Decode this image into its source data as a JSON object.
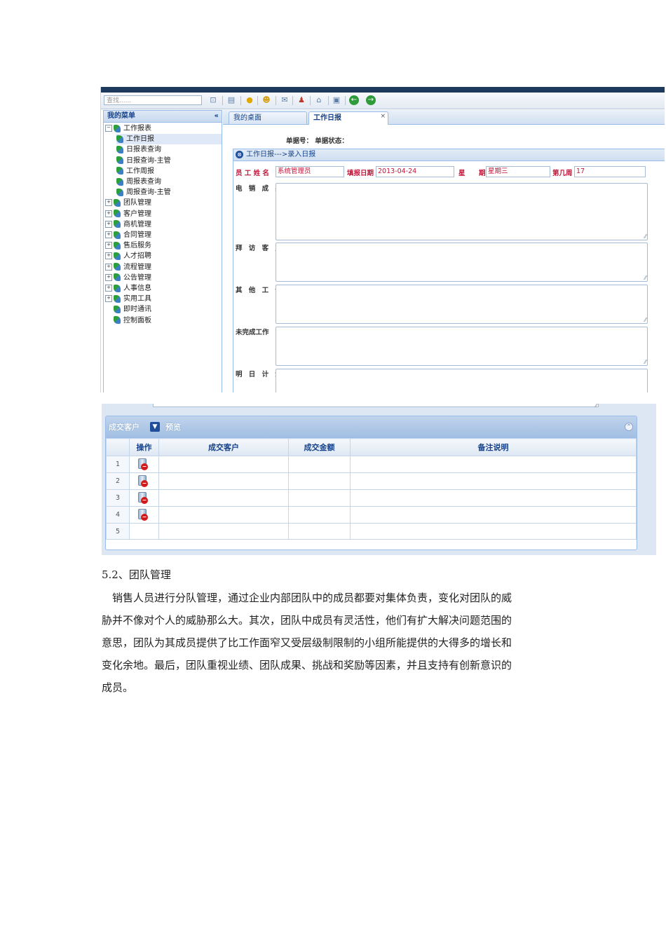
{
  "app": {
    "search_placeholder": "查找......",
    "sidebar": {
      "title": "我的菜单",
      "collapse_glyph": "«",
      "items": [
        {
          "label": "工作报表",
          "expander": "⊟",
          "level": 0
        },
        {
          "label": "工作日报",
          "level": 1,
          "selected": true
        },
        {
          "label": "日报表查询",
          "level": 1
        },
        {
          "label": "日报查询-主管",
          "level": 1
        },
        {
          "label": "工作周报",
          "level": 1
        },
        {
          "label": "周报表查询",
          "level": 1
        },
        {
          "label": "周报查询-主管",
          "level": 1
        },
        {
          "label": "团队管理",
          "expander": "⊞",
          "level": 0
        },
        {
          "label": "客户管理",
          "expander": "⊞",
          "level": 0
        },
        {
          "label": "商机管理",
          "expander": "⊞",
          "level": 0
        },
        {
          "label": "合同管理",
          "expander": "⊞",
          "level": 0
        },
        {
          "label": "售后服务",
          "expander": "⊞",
          "level": 0
        },
        {
          "label": "人才招聘",
          "expander": "⊞",
          "level": 0
        },
        {
          "label": "流程管理",
          "expander": "⊞",
          "level": 0
        },
        {
          "label": "公告管理",
          "expander": "⊞",
          "level": 0
        },
        {
          "label": "人事信息",
          "expander": "⊞",
          "level": 0
        },
        {
          "label": "实用工具",
          "expander": "⊞",
          "level": 0
        },
        {
          "label": "即时通讯",
          "level": 0
        },
        {
          "label": "控制面板",
          "level": 0
        }
      ]
    },
    "tabs": [
      {
        "label": "我的桌面"
      },
      {
        "label": "工作日报",
        "close": "×"
      }
    ],
    "form": {
      "doc_meta": "单据号：   单据状态：",
      "panel_title": "工作日报---&gt;录入日报",
      "employee_label": "员 工 姓 名",
      "employee_value": "系统管理员",
      "date_label": "填报日期",
      "date_value": "2013-04-24",
      "weekday_label": "星　　期",
      "weekday_value": "星期三",
      "week_label": "第几周",
      "week_value": "17",
      "textareas": [
        {
          "label": "电 销 成 果"
        },
        {
          "label": "拜 访 客 户"
        },
        {
          "label": "其 他 工 作"
        },
        {
          "label": "未完成工作"
        },
        {
          "label": "明 日 计 划"
        }
      ]
    },
    "grid": {
      "title": "成交客户",
      "dropdown_glyph": "▼",
      "preview": "预览",
      "collapse_glyph": "⌃",
      "columns": [
        "操作",
        "成交客户",
        "成交金额",
        "备注说明"
      ],
      "rows": [
        {
          "num": "1",
          "has_delete": true
        },
        {
          "num": "2",
          "has_delete": true
        },
        {
          "num": "3",
          "has_delete": true
        },
        {
          "num": "4",
          "has_delete": true
        },
        {
          "num": "5",
          "has_delete": false
        }
      ]
    }
  },
  "document": {
    "section_title": "5.2、团队管理",
    "paragraph_lines": [
      "　销售人员进行分队管理，通过企业内部团队中的成员都要对集体负责，变化对团队的威",
      "胁并不像对个人的威胁那么大。其次，团队中成员有灵活性，他们有扩大解决问题范围的",
      "意思，团队为其成员提供了比工作面窄又受层级制限制的小组所能提供的大得多的增长和",
      "变化余地。最后，团队重视业绩、团队成果、挑战和奖励等因素，并且支持有创新意识的",
      "成员。"
    ]
  },
  "colors": {
    "header_dark": "#1d3a5c",
    "panel_border": "#99bbe8",
    "label_blue": "#15428b",
    "value_red": "#c0163a"
  }
}
